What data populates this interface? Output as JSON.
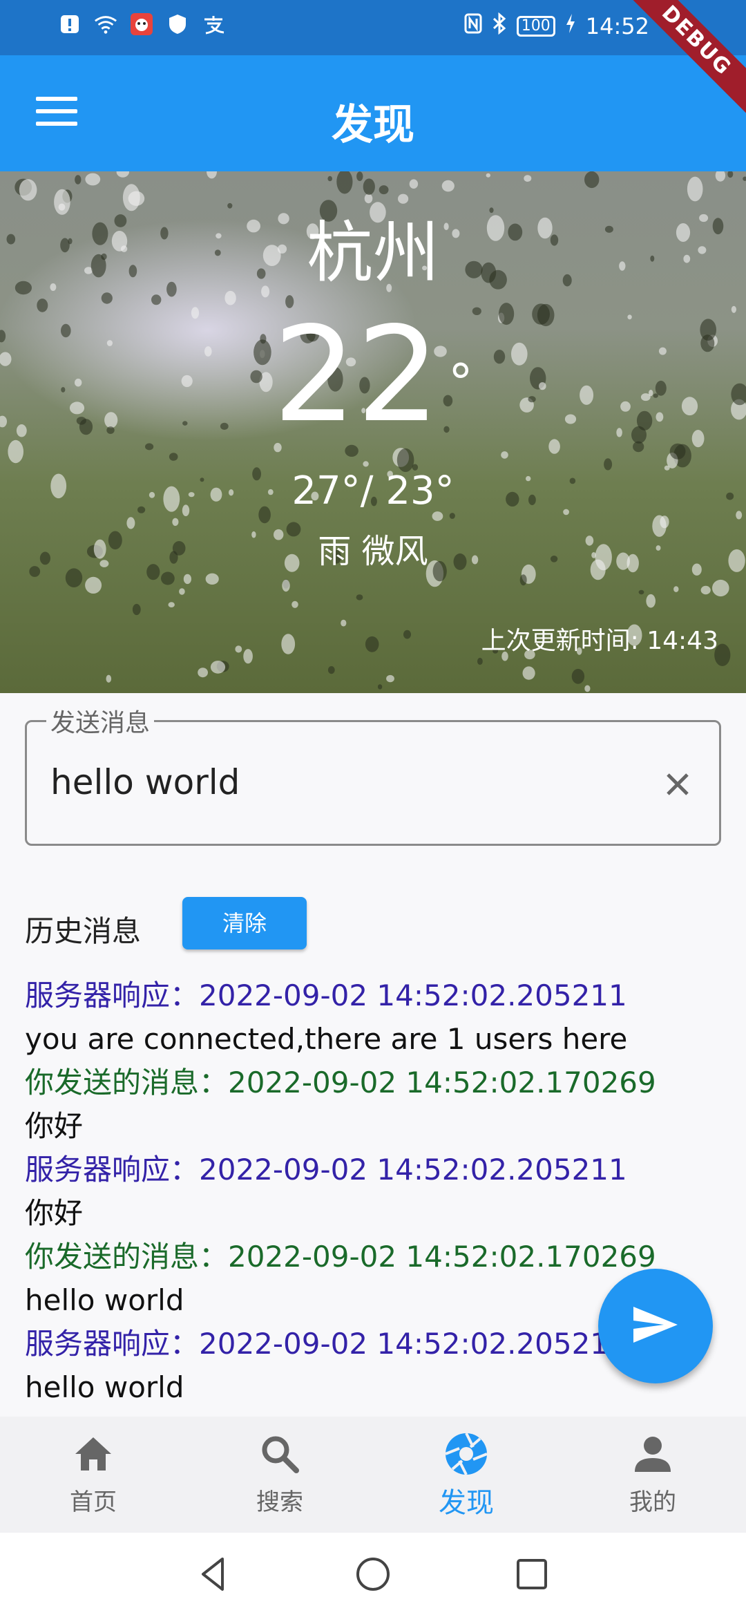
{
  "status_bar": {
    "battery": "100",
    "time": "14:52",
    "debug_badge": "DEBUG"
  },
  "app_bar": {
    "title": "发现"
  },
  "weather": {
    "city": "杭州",
    "temperature": "22",
    "degree_symbol": "°",
    "range": "27°/ 23°",
    "description": "雨 微风",
    "updated": "上次更新时间: 14:43"
  },
  "input": {
    "label": "发送消息",
    "value": "hello world"
  },
  "history": {
    "label": "历史消息",
    "clear_label": "清除",
    "lines": [
      {
        "type": "server",
        "text": "服务器响应：2022-09-02 14:52:02.205211"
      },
      {
        "type": "body",
        "text": "you are connected,there are 1 users here"
      },
      {
        "type": "sent",
        "text": "你发送的消息：2022-09-02 14:52:02.170269"
      },
      {
        "type": "body",
        "text": "你好"
      },
      {
        "type": "server",
        "text": "服务器响应：2022-09-02 14:52:02.205211"
      },
      {
        "type": "body",
        "text": "你好"
      },
      {
        "type": "sent",
        "text": "你发送的消息：2022-09-02 14:52:02.170269"
      },
      {
        "type": "body",
        "text": "hello world"
      },
      {
        "type": "server",
        "text": "服务器响应：2022-09-02 14:52:02.205211"
      },
      {
        "type": "body",
        "text": "hello world"
      }
    ]
  },
  "nav": {
    "items": [
      {
        "label": "首页",
        "icon": "home-icon"
      },
      {
        "label": "搜索",
        "icon": "search-icon"
      },
      {
        "label": "发现",
        "icon": "aperture-icon",
        "active": true
      },
      {
        "label": "我的",
        "icon": "person-icon"
      }
    ]
  },
  "colors": {
    "primary": "#2196f3",
    "server_text": "#3322a8",
    "sent_text": "#1a6a2a"
  }
}
